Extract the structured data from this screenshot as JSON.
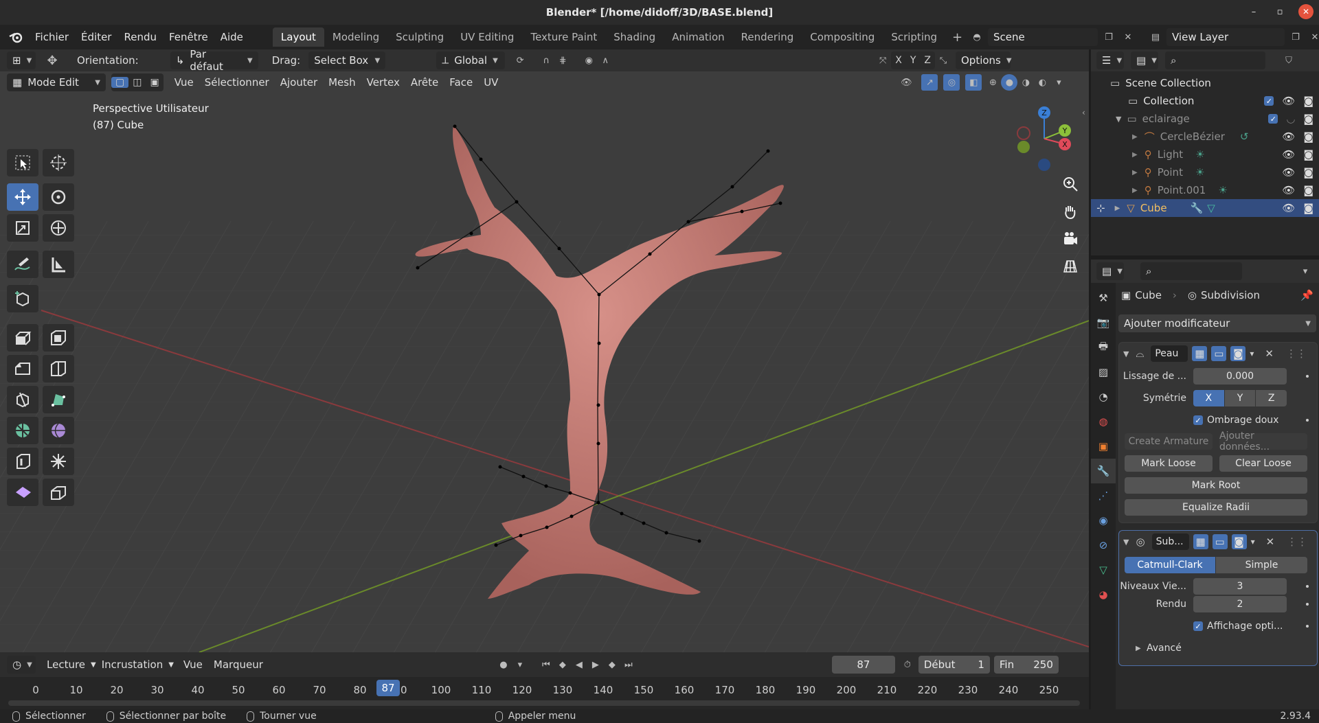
{
  "window": {
    "title": "Blender* [/home/didoff/3D/BASE.blend]"
  },
  "menu": {
    "items": [
      "Fichier",
      "Éditer",
      "Rendu",
      "Fenêtre",
      "Aide"
    ]
  },
  "workspaces": {
    "tabs": [
      "Layout",
      "Modeling",
      "Sculpting",
      "UV Editing",
      "Texture Paint",
      "Shading",
      "Animation",
      "Rendering",
      "Compositing",
      "Scripting"
    ],
    "active": "Layout"
  },
  "scene": {
    "name": "Scene",
    "view_layer": "View Layer"
  },
  "viewport_header": {
    "orientation_label": "Orientation:",
    "orientation_value": "Par défaut",
    "drag_label": "Drag:",
    "drag_value": "Select Box",
    "transform_value": "Global",
    "axes": [
      "X",
      "Y",
      "Z"
    ],
    "options_label": "Options",
    "mode_value": "Mode Edit",
    "menus": [
      "Vue",
      "Sélectionner",
      "Ajouter",
      "Mesh",
      "Vertex",
      "Arête",
      "Face",
      "UV"
    ]
  },
  "viewport": {
    "perspective": "Perspective Utilisateur",
    "object_info": "(87) Cube",
    "gizmo_axes": [
      "Z",
      "Y",
      "X"
    ]
  },
  "timeline": {
    "menus": [
      "Lecture",
      "Incrustation",
      "Vue",
      "Marqueur"
    ],
    "current_frame": "87",
    "start_label": "Début",
    "start_value": "1",
    "end_label": "Fin",
    "end_value": "250",
    "ticks": [
      "0",
      "10",
      "20",
      "30",
      "40",
      "50",
      "60",
      "70",
      "80",
      "90",
      "100",
      "110",
      "120",
      "130",
      "140",
      "150",
      "160",
      "170",
      "180",
      "190",
      "200",
      "210",
      "220",
      "230",
      "240",
      "250"
    ],
    "playhead": "87"
  },
  "statusbar": {
    "items": [
      "Sélectionner",
      "Sélectionner par boîte",
      "Tourner vue",
      "Appeler menu"
    ],
    "version": "2.93.4"
  },
  "outliner": {
    "rows": [
      {
        "name": "Scene Collection"
      },
      {
        "name": "Collection"
      },
      {
        "name": "eclairage"
      },
      {
        "name": "CercleBézier"
      },
      {
        "name": "Light"
      },
      {
        "name": "Point"
      },
      {
        "name": "Point.001"
      },
      {
        "name": "Cube"
      }
    ]
  },
  "properties": {
    "breadcrumb_object": "Cube",
    "breadcrumb_modifier": "Subdivision",
    "add_modifier": "Ajouter modificateur",
    "skin": {
      "name": "Peau",
      "smooth_label": "Lissage de ...",
      "smooth_value": "0.000",
      "symmetry_label": "Symétrie",
      "symmetry": [
        "X",
        "Y",
        "Z"
      ],
      "smooth_shading": "Ombrage doux",
      "create_armature": "Create Armature",
      "add_data": "Ajouter données...",
      "mark_loose": "Mark Loose",
      "clear_loose": "Clear Loose",
      "mark_root": "Mark Root",
      "equalize_radii": "Equalize Radii"
    },
    "subdivision": {
      "name": "Sub...",
      "catmull": "Catmull-Clark",
      "simple": "Simple",
      "levels_label": "Niveaux Vie...",
      "levels_value": "3",
      "render_label": "Rendu",
      "render_value": "2",
      "optimal_display": "Affichage opti...",
      "advanced": "Avancé"
    }
  },
  "colors": {
    "accent": "#4772b3",
    "mesh": "#c37a73",
    "x_axis": "#e04a5a",
    "y_axis": "#8cc03a",
    "z_axis": "#3a7fd6"
  }
}
